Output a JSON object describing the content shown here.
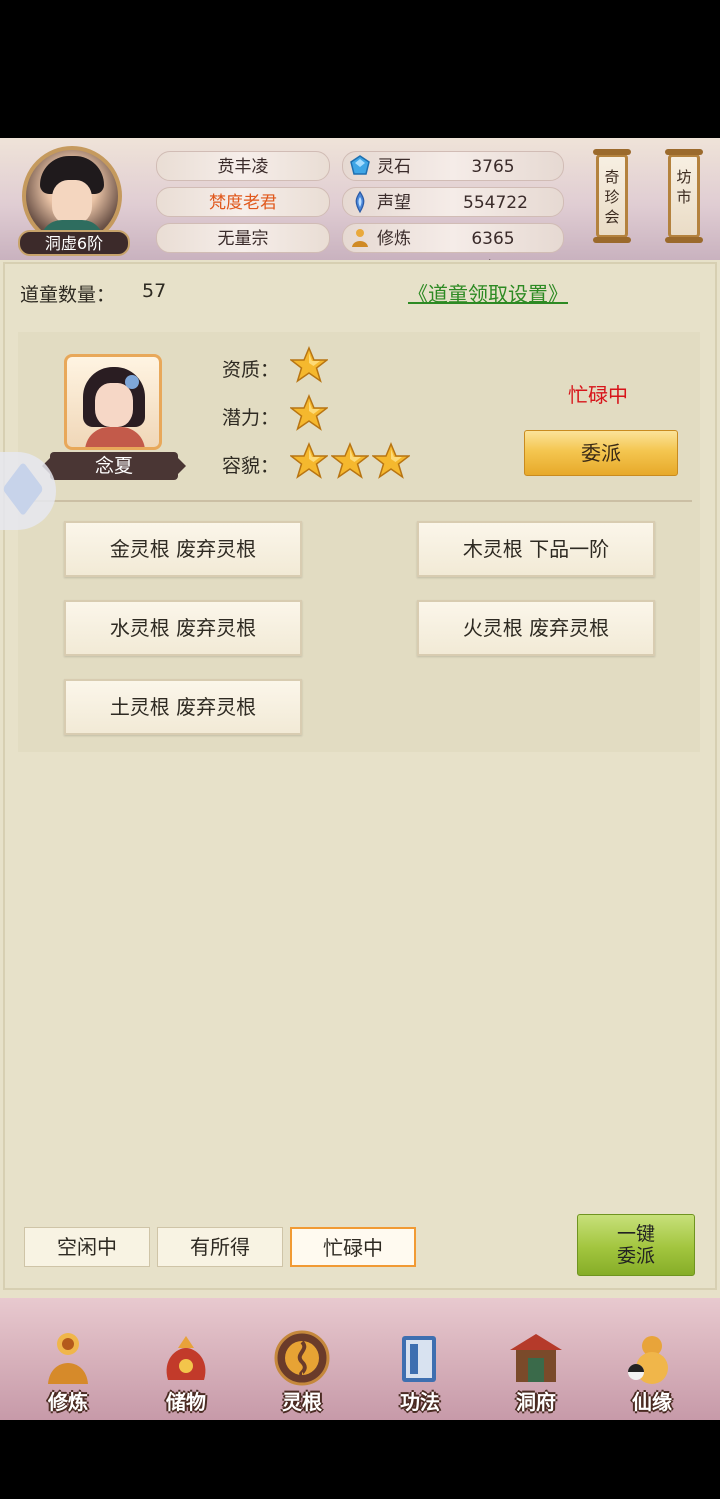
{
  "header": {
    "rank": "洞虚6阶",
    "player_name": "贲丰凌",
    "master_name": "梵度老君",
    "sect": "无量宗",
    "stats": [
      {
        "icon": "spirit-stone-icon",
        "label": "灵石",
        "value": "3765"
      },
      {
        "icon": "reputation-icon",
        "label": "声望",
        "value": "554722"
      },
      {
        "icon": "cultivation-icon",
        "label": "修炼",
        "value": "6365年"
      }
    ],
    "scroll_buttons": [
      "奇珍会",
      "坊市"
    ]
  },
  "main": {
    "tong_count_label": "道童数量：",
    "tong_count": "57",
    "settings_link": "《道童领取设置》",
    "disciple": {
      "name": "念夏",
      "attributes": [
        {
          "label": "资质：",
          "stars": 1
        },
        {
          "label": "潜力：",
          "stars": 1
        },
        {
          "label": "容貌：",
          "stars": 3
        }
      ],
      "status": "忙碌中",
      "assign_button": "委派",
      "roots": [
        "金灵根 废弃灵根",
        "木灵根 下品一阶",
        "水灵根 废弃灵根",
        "火灵根 废弃灵根",
        "土灵根 废弃灵根"
      ]
    },
    "tabs": [
      "空闲中",
      "有所得",
      "忙碌中"
    ],
    "active_tab": "忙碌中",
    "onekey_button": [
      "一键",
      "委派"
    ]
  },
  "nav": [
    {
      "label": "修炼",
      "icon": "cultivate-icon"
    },
    {
      "label": "储物",
      "icon": "storage-bag-icon"
    },
    {
      "label": "灵根",
      "icon": "spirit-root-icon"
    },
    {
      "label": "功法",
      "icon": "scripture-icon"
    },
    {
      "label": "洞府",
      "icon": "cave-mansion-icon"
    },
    {
      "label": "仙缘",
      "icon": "fate-gourd-icon"
    }
  ],
  "colors": {
    "status_red": "#d7141a",
    "link_green": "#2d8a23",
    "star_gold": "#f5b82e"
  }
}
